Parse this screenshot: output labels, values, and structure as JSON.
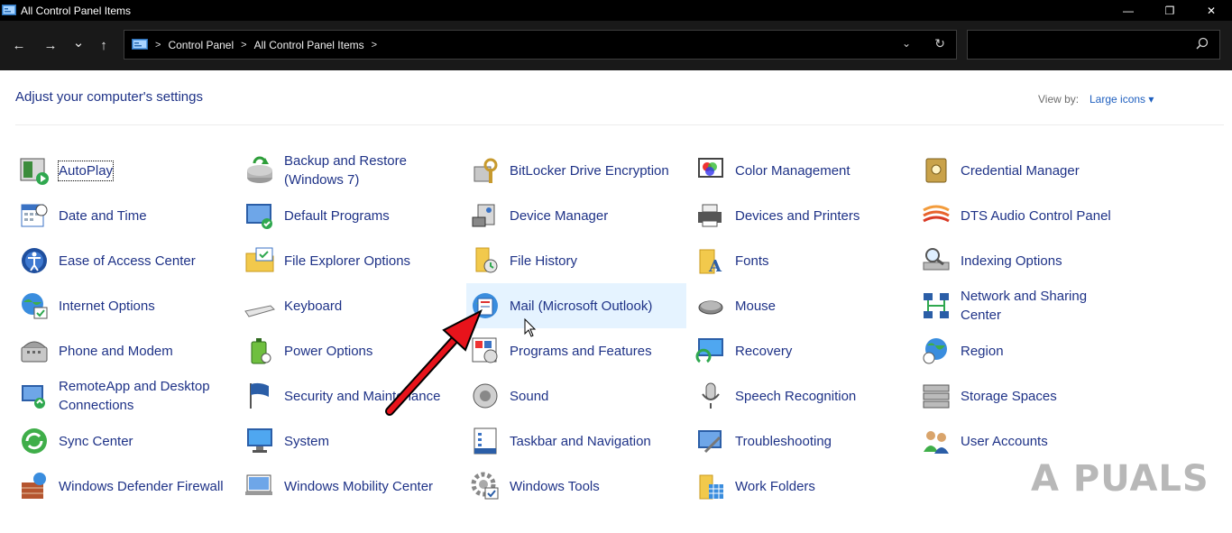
{
  "window": {
    "title": "All Control Panel Items",
    "minimize": "—",
    "maximize": "❐",
    "close": "✕"
  },
  "address": {
    "back": "←",
    "forward": "→",
    "recent": "⌄",
    "up": "↑",
    "separator": ">",
    "crumbs": [
      "Control Panel",
      "All Control Panel Items"
    ],
    "dropdown": "⌄",
    "refresh": "↻",
    "search_placeholder": ""
  },
  "header": {
    "title": "Adjust your computer's settings",
    "view_by_label": "View by:",
    "view_by_value": "Large icons ▾"
  },
  "items": [
    {
      "label": "AutoPlay",
      "icon": "autoplay-icon"
    },
    {
      "label": "Backup and Restore (Windows 7)",
      "icon": "backup-icon"
    },
    {
      "label": "BitLocker Drive Encryption",
      "icon": "bitlocker-icon"
    },
    {
      "label": "Color Management",
      "icon": "color-management-icon"
    },
    {
      "label": "Credential Manager",
      "icon": "credential-icon"
    },
    {
      "label": "Date and Time",
      "icon": "calendar-icon"
    },
    {
      "label": "Default Programs",
      "icon": "default-programs-icon"
    },
    {
      "label": "Device Manager",
      "icon": "device-manager-icon"
    },
    {
      "label": "Devices and Printers",
      "icon": "printer-icon"
    },
    {
      "label": "DTS Audio Control Panel",
      "icon": "dts-audio-icon"
    },
    {
      "label": "Ease of Access Center",
      "icon": "ease-of-access-icon"
    },
    {
      "label": "File Explorer Options",
      "icon": "folder-options-icon"
    },
    {
      "label": "File History",
      "icon": "file-history-icon"
    },
    {
      "label": "Fonts",
      "icon": "fonts-icon"
    },
    {
      "label": "Indexing Options",
      "icon": "indexing-icon"
    },
    {
      "label": "Internet Options",
      "icon": "internet-options-icon"
    },
    {
      "label": "Keyboard",
      "icon": "keyboard-icon"
    },
    {
      "label": "Mail (Microsoft Outlook)",
      "icon": "mail-icon"
    },
    {
      "label": "Mouse",
      "icon": "mouse-icon"
    },
    {
      "label": "Network and Sharing Center",
      "icon": "network-icon"
    },
    {
      "label": "Phone and Modem",
      "icon": "phone-icon"
    },
    {
      "label": "Power Options",
      "icon": "battery-icon"
    },
    {
      "label": "Programs and Features",
      "icon": "programs-icon"
    },
    {
      "label": "Recovery",
      "icon": "recovery-icon"
    },
    {
      "label": "Region",
      "icon": "region-icon"
    },
    {
      "label": "RemoteApp and Desktop Connections",
      "icon": "remoteapp-icon"
    },
    {
      "label": "Security and Maintenance",
      "icon": "flag-icon"
    },
    {
      "label": "Sound",
      "icon": "speaker-icon"
    },
    {
      "label": "Speech Recognition",
      "icon": "microphone-icon"
    },
    {
      "label": "Storage Spaces",
      "icon": "storage-icon"
    },
    {
      "label": "Sync Center",
      "icon": "sync-icon"
    },
    {
      "label": "System",
      "icon": "monitor-icon"
    },
    {
      "label": "Taskbar and Navigation",
      "icon": "taskbar-icon"
    },
    {
      "label": "Troubleshooting",
      "icon": "troubleshooting-icon"
    },
    {
      "label": "User Accounts",
      "icon": "users-icon"
    },
    {
      "label": "Windows Defender Firewall",
      "icon": "firewall-icon"
    },
    {
      "label": "Windows Mobility Center",
      "icon": "mobility-icon"
    },
    {
      "label": "Windows Tools",
      "icon": "gear-icon"
    },
    {
      "label": "Work Folders",
      "icon": "work-folders-icon"
    }
  ],
  "watermark": "A  PUALS",
  "colors": {
    "link": "#1e3287",
    "hover_bg": "#e5f3ff",
    "arrow": "#e8131b"
  }
}
